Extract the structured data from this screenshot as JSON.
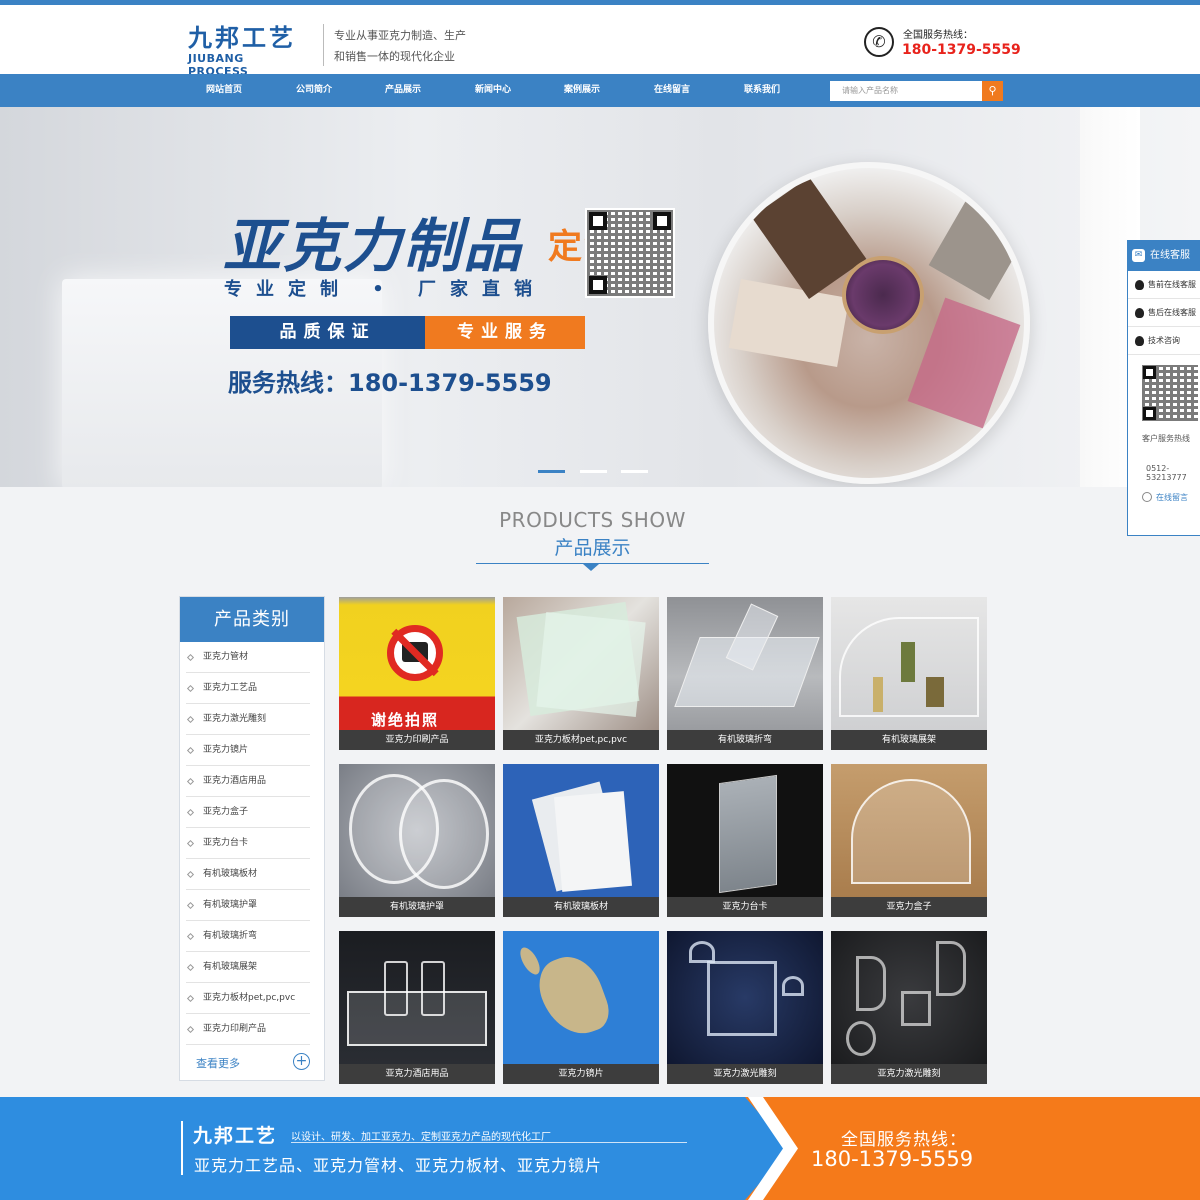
{
  "header": {
    "logo_cn": "九邦工艺",
    "logo_en": "JIUBANG PROCESS",
    "slogan_line1": "专业从事亚克力制造、生产",
    "slogan_line2": "和销售一体的现代化企业",
    "hotline_label": "全国服务热线：",
    "hotline_number": "180-1379-5559"
  },
  "nav": {
    "items": [
      "网站首页",
      "公司简介",
      "产品展示",
      "新闻中心",
      "案例展示",
      "在线留言",
      "联系我们"
    ],
    "search_placeholder": "请输入产品名称",
    "search_icon": "search-icon"
  },
  "banner": {
    "title": "亚克力制品",
    "title_accent": "定制",
    "subtitle": "专业定制 • 厂家直销",
    "badge_left": "品质保证",
    "badge_right": "专业服务",
    "hotline": "服务热线：180-1379-5559",
    "active_slide": 1,
    "slide_count": 3
  },
  "side_panel": {
    "title": "在线客服",
    "items": [
      "售前在线客服",
      "售后在线客服",
      "技术咨询"
    ],
    "qr_caption": "客户服务热线",
    "phone": "0512-53213777",
    "message": "在线留言"
  },
  "section": {
    "title_en": "PRODUCTS SHOW",
    "title_cn": "产品展示"
  },
  "categories": {
    "title": "产品类别",
    "items": [
      "亚克力管材",
      "亚克力工艺品",
      "亚克力激光雕刻",
      "亚克力镜片",
      "亚克力酒店用品",
      "亚克力盒子",
      "亚克力台卡",
      "有机玻璃板材",
      "有机玻璃护罩",
      "有机玻璃折弯",
      "有机玻璃展架",
      "亚克力板材pet,pc,pvc",
      "亚克力印刷产品"
    ],
    "more": "查看更多",
    "plus": "+"
  },
  "products": [
    {
      "caption": "亚克力印刷产品"
    },
    {
      "caption": "亚克力板材pet,pc,pvc"
    },
    {
      "caption": "有机玻璃折弯"
    },
    {
      "caption": "有机玻璃展架"
    },
    {
      "caption": "有机玻璃护罩"
    },
    {
      "caption": "有机玻璃板材"
    },
    {
      "caption": "亚克力台卡"
    },
    {
      "caption": "亚克力盒子"
    },
    {
      "caption": "亚克力酒店用品"
    },
    {
      "caption": "亚克力镜片"
    },
    {
      "caption": "亚克力激光雕刻"
    },
    {
      "caption": "亚克力激光雕刻"
    }
  ],
  "product_photo": {
    "sign_text": "谢绝拍照"
  },
  "footer": {
    "brand": "九邦工艺",
    "desc": "以设计、研发、加工亚克力、定制亚克力产品的现代化工厂",
    "products": "亚克力工艺品、亚克力管材、亚克力板材、亚克力镜片",
    "hotline_label": "全国服务热线：",
    "hotline_number": "180-1379-5559"
  },
  "colors": {
    "brand_blue": "#3b82c4",
    "accent_orange": "#f07a1f",
    "hotline_red": "#e8231c"
  }
}
